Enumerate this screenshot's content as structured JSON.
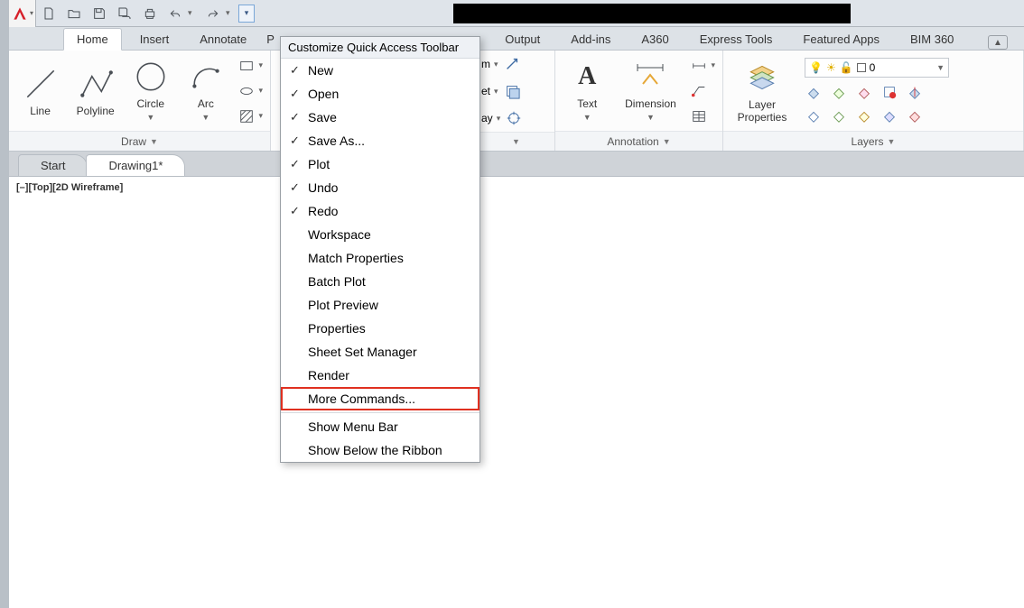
{
  "tabs": [
    "Home",
    "Insert",
    "Annotate",
    "P",
    "Output",
    "Add-ins",
    "A360",
    "Express Tools",
    "Featured Apps",
    "BIM 360"
  ],
  "active_tab": "Home",
  "qat_menu": {
    "title": "Customize Quick Access Toolbar",
    "items": [
      {
        "label": "New",
        "checked": true
      },
      {
        "label": "Open",
        "checked": true
      },
      {
        "label": "Save",
        "checked": true
      },
      {
        "label": "Save As...",
        "checked": true
      },
      {
        "label": "Plot",
        "checked": true
      },
      {
        "label": "Undo",
        "checked": true
      },
      {
        "label": "Redo",
        "checked": true
      },
      {
        "label": "Workspace",
        "checked": false
      },
      {
        "label": "Match Properties",
        "checked": false
      },
      {
        "label": "Batch Plot",
        "checked": false
      },
      {
        "label": "Plot Preview",
        "checked": false
      },
      {
        "label": "Properties",
        "checked": false
      },
      {
        "label": "Sheet Set Manager",
        "checked": false
      },
      {
        "label": "Render",
        "checked": false
      },
      {
        "label": "More Commands...",
        "checked": false,
        "highlight": true
      },
      {
        "label": "Show Menu Bar",
        "checked": false
      },
      {
        "label": "Show Below the Ribbon",
        "checked": false
      }
    ]
  },
  "ribbon": {
    "draw": {
      "title": "Draw",
      "tools": [
        {
          "label": "Line"
        },
        {
          "label": "Polyline"
        },
        {
          "label": "Circle",
          "dd": true
        },
        {
          "label": "Arc",
          "dd": true
        }
      ]
    },
    "modify_stub": {
      "rows": [
        "et",
        "ay"
      ]
    },
    "annotation": {
      "title": "Annotation",
      "text": "Text",
      "dimension": "Dimension"
    },
    "layers": {
      "title": "Layers",
      "prop": "Layer\nProperties",
      "current": "0"
    }
  },
  "doctabs": [
    {
      "label": "Start",
      "active": false
    },
    {
      "label": "Drawing1*",
      "active": true
    }
  ],
  "viewport": "[–][Top][2D Wireframe]"
}
